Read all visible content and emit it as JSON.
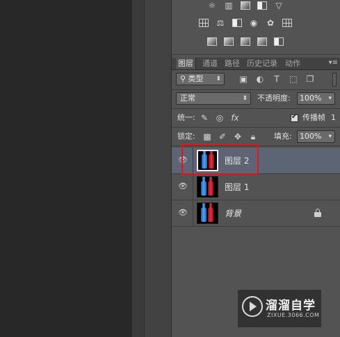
{
  "panel_tabs": {
    "layers": "图层",
    "channels": "通道",
    "paths": "路径",
    "history": "历史记录",
    "actions": "动作"
  },
  "filter": {
    "kind_label": "类型"
  },
  "blend": {
    "mode": "正常",
    "opacity_label": "不透明度:",
    "opacity_value": "100%"
  },
  "unify": {
    "label": "统一:",
    "propagate_label": "传播帧",
    "propagate_value": "1",
    "propagate_checked": true
  },
  "lock_row": {
    "label": "锁定:",
    "fill_label": "填充:",
    "fill_value": "100%"
  },
  "layers": [
    {
      "name": "图层 2",
      "visible": true,
      "selected": true,
      "locked": false
    },
    {
      "name": "图层 1",
      "visible": true,
      "selected": false,
      "locked": false
    },
    {
      "name": "背景",
      "visible": true,
      "selected": false,
      "locked": true
    }
  ],
  "watermark": {
    "title": "溜溜自学",
    "url": "ZIXUE.3066.COM"
  },
  "colors": {
    "selected_layer": "#5d6575",
    "highlight_box": "#e0141e"
  }
}
